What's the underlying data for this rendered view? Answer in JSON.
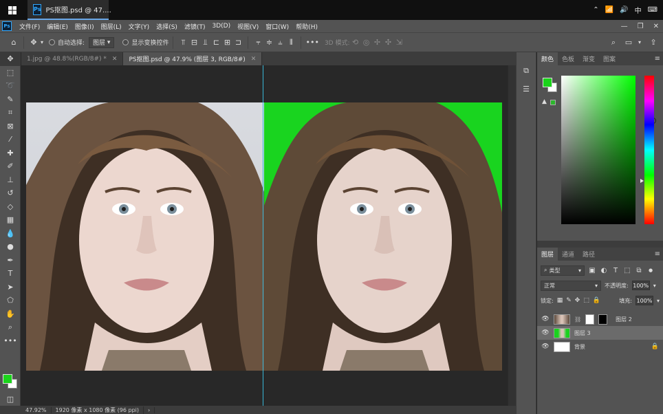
{
  "taskbar": {
    "app_title": "PS抠图.psd @ 47....",
    "tray_lang": "中",
    "tray_icons": [
      "chevron-up-icon",
      "wifi-icon",
      "volume-icon",
      "keyboard-icon"
    ]
  },
  "menu": {
    "items": [
      "文件(F)",
      "编辑(E)",
      "图像(I)",
      "图层(L)",
      "文字(Y)",
      "选择(S)",
      "滤镜(T)",
      "3D(D)",
      "视图(V)",
      "窗口(W)",
      "帮助(H)"
    ]
  },
  "options": {
    "auto_select_label": "自动选择:",
    "auto_select_value": "图层",
    "transform_label": "显示变换控件",
    "mode_3d_label": "3D 模式:"
  },
  "tabs": [
    {
      "label": "1.jpg @ 48.8%(RGB/8#) *",
      "active": false
    },
    {
      "label": "PS抠图.psd @ 47.9% (图层 3, RGB/8#)",
      "active": true
    }
  ],
  "status": {
    "zoom": "47.92%",
    "doc_size": "1920 像素 x 1080 像素 (96 ppi)",
    "arrow": "›"
  },
  "color_panel": {
    "tabs": [
      "颜色",
      "色板",
      "渐变",
      "图案"
    ],
    "foreground": "#1bd41b",
    "background": "#ffffff"
  },
  "layers_panel": {
    "tabs": [
      "图层",
      "通道",
      "路径"
    ],
    "filter_label": "类型",
    "blend_mode": "正常",
    "opacity_label": "不透明度:",
    "opacity_value": "100%",
    "lock_label": "锁定:",
    "fill_label": "填充:",
    "fill_value": "100%",
    "layers": [
      {
        "name": "图层 2",
        "selected": false,
        "has_mask": true
      },
      {
        "name": "图层 3",
        "selected": true,
        "has_mask": false
      },
      {
        "name": "背景",
        "selected": false,
        "has_mask": false,
        "locked": true
      }
    ]
  },
  "colors": {
    "chroma_green": "#19d41f",
    "guide": "#37b7d8"
  }
}
